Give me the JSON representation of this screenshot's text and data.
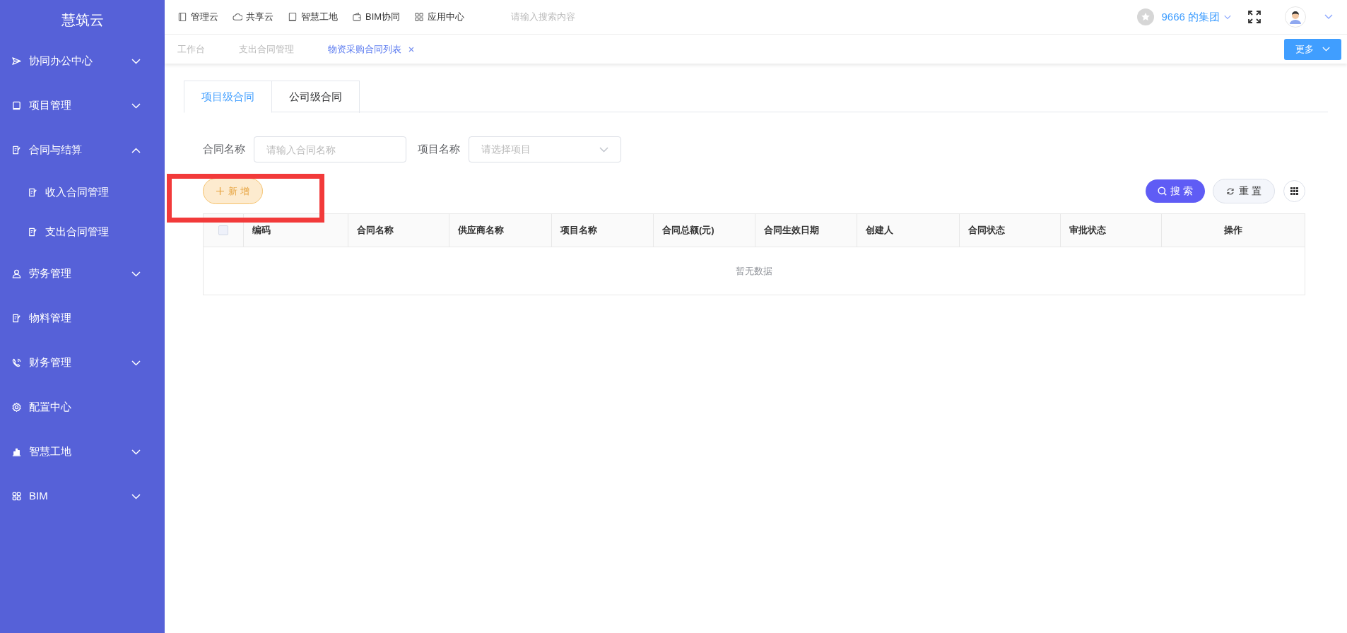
{
  "sidebar": {
    "title": "慧筑云",
    "items": [
      {
        "label": "协同办公中心",
        "expanded": false
      },
      {
        "label": "项目管理",
        "expanded": false
      },
      {
        "label": "合同与结算",
        "expanded": true,
        "children": [
          {
            "label": "收入合同管理"
          },
          {
            "label": "支出合同管理"
          }
        ]
      },
      {
        "label": "劳务管理",
        "expanded": false
      },
      {
        "label": "物料管理"
      },
      {
        "label": "财务管理",
        "expanded": false
      },
      {
        "label": "配置中心"
      },
      {
        "label": "智慧工地",
        "expanded": false
      },
      {
        "label": "BIM",
        "expanded": false
      }
    ]
  },
  "top_nav": {
    "links": [
      {
        "label": "管理云"
      },
      {
        "label": "共享云"
      },
      {
        "label": "智慧工地"
      },
      {
        "label": "BIM协同"
      },
      {
        "label": "应用中心"
      }
    ],
    "search": {
      "placeholder": "请输入搜索内容"
    },
    "organization": "9666 的集团"
  },
  "page_tabs": [
    {
      "label": "工作台",
      "selected": false,
      "closable": false
    },
    {
      "label": "支出合同管理",
      "selected": false,
      "closable": false
    },
    {
      "label": "物资采购合同列表",
      "selected": true,
      "closable": true
    }
  ],
  "more_button": "更多",
  "content_tabs": [
    {
      "label": "项目级合同",
      "selected": true
    },
    {
      "label": "公司级合同",
      "selected": false
    }
  ],
  "filters": [
    {
      "label": "合同名称",
      "kind": "input",
      "placeholder": "请输入合同名称"
    },
    {
      "label": "项目名称",
      "kind": "select",
      "placeholder": "请选择项目"
    }
  ],
  "add_button": "新 增",
  "search_button": "搜 索",
  "reset_button": "重 置",
  "table": {
    "columns": [
      "编码",
      "合同名称",
      "供应商名称",
      "项目名称",
      "合同总额(元)",
      "合同生效日期",
      "创建人",
      "合同状态",
      "审批状态",
      "操作"
    ],
    "select_all_checked": false,
    "empty_text": "暂无数据"
  }
}
